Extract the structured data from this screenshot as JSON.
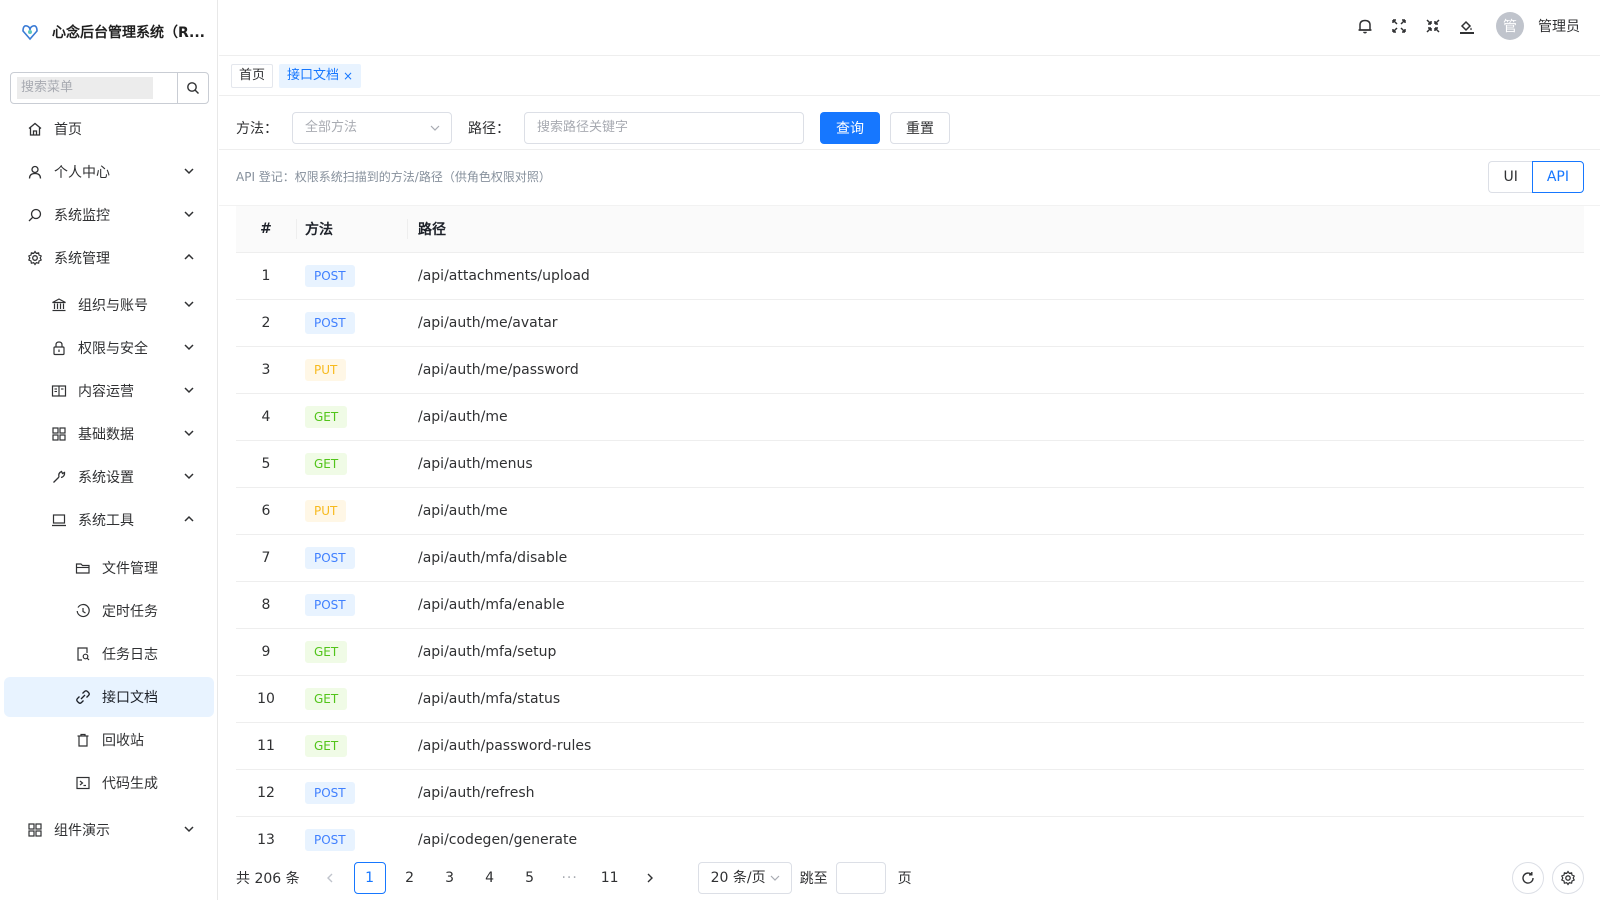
{
  "app": {
    "title": "心念后台管理系统（R..."
  },
  "sidebar": {
    "search_placeholder": "搜索菜单",
    "items": [
      {
        "label": "首页",
        "icon": "home-icon"
      },
      {
        "label": "个人中心",
        "icon": "user-icon"
      },
      {
        "label": "系统监控",
        "icon": "monitor-icon"
      },
      {
        "label": "系统管理",
        "icon": "gear-icon"
      },
      {
        "label": "组织与账号",
        "icon": "bank-icon"
      },
      {
        "label": "权限与安全",
        "icon": "lock-icon"
      },
      {
        "label": "内容运营",
        "icon": "book-icon"
      },
      {
        "label": "基础数据",
        "icon": "grid-icon"
      },
      {
        "label": "系统设置",
        "icon": "wrench-icon"
      },
      {
        "label": "系统工具",
        "icon": "laptop-icon"
      },
      {
        "label": "文件管理",
        "icon": "folder-icon"
      },
      {
        "label": "定时任务",
        "icon": "clock-icon"
      },
      {
        "label": "任务日志",
        "icon": "log-search-icon"
      },
      {
        "label": "接口文档",
        "icon": "api-link-icon"
      },
      {
        "label": "回收站",
        "icon": "trash-icon"
      },
      {
        "label": "代码生成",
        "icon": "code-icon"
      },
      {
        "label": "组件演示",
        "icon": "grid-icon"
      }
    ]
  },
  "header": {
    "user_name": "管理员",
    "avatar_text": "管"
  },
  "tabs": [
    {
      "label": "首页"
    },
    {
      "label": "接口文档",
      "close": "×"
    }
  ],
  "filter": {
    "method_label": "方法：",
    "method_placeholder": "全部方法",
    "path_label": "路径：",
    "path_placeholder": "搜索路径关键字",
    "query_btn": "查询",
    "reset_btn": "重置"
  },
  "hint": "API 登记：权限系统扫描到的方法/路径（供角色权限对照）",
  "view_toggle": {
    "ui": "UI",
    "api": "API",
    "selected": "API"
  },
  "table": {
    "headers": {
      "idx": "#",
      "method": "方法",
      "path": "路径"
    },
    "rows": [
      {
        "idx": "1",
        "method": "POST",
        "path": "/api/attachments/upload"
      },
      {
        "idx": "2",
        "method": "POST",
        "path": "/api/auth/me/avatar"
      },
      {
        "idx": "3",
        "method": "PUT",
        "path": "/api/auth/me/password"
      },
      {
        "idx": "4",
        "method": "GET",
        "path": "/api/auth/me"
      },
      {
        "idx": "5",
        "method": "GET",
        "path": "/api/auth/menus"
      },
      {
        "idx": "6",
        "method": "PUT",
        "path": "/api/auth/me"
      },
      {
        "idx": "7",
        "method": "POST",
        "path": "/api/auth/mfa/disable"
      },
      {
        "idx": "8",
        "method": "POST",
        "path": "/api/auth/mfa/enable"
      },
      {
        "idx": "9",
        "method": "GET",
        "path": "/api/auth/mfa/setup"
      },
      {
        "idx": "10",
        "method": "GET",
        "path": "/api/auth/mfa/status"
      },
      {
        "idx": "11",
        "method": "GET",
        "path": "/api/auth/password-rules"
      },
      {
        "idx": "12",
        "method": "POST",
        "path": "/api/auth/refresh"
      },
      {
        "idx": "13",
        "method": "POST",
        "path": "/api/codegen/generate"
      }
    ]
  },
  "pagination": {
    "total": "共 206 条",
    "pages": [
      "1",
      "2",
      "3",
      "4",
      "5",
      "···",
      "11"
    ],
    "current": "1",
    "page_size": "20 条/页",
    "jump_label": "跳至",
    "page_suffix": "页"
  },
  "colors": {
    "primary": "#1677ff",
    "post": "#4080ff",
    "put": "#f7ba1e",
    "get": "#52c41a"
  }
}
